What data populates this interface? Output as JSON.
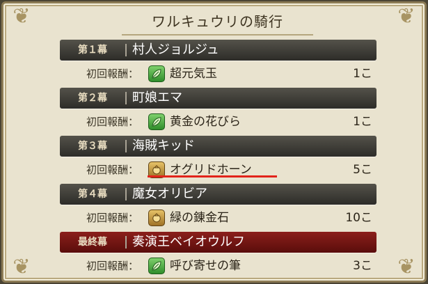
{
  "title": "ワルキュウリの騎行",
  "chapters": [
    {
      "num": "第１幕",
      "name": "村人ジョルジュ",
      "reward_label": "初回報酬：",
      "reward_icon": "green-leaf-icon",
      "reward_item": "超元気玉",
      "reward_qty": "1こ"
    },
    {
      "num": "第２幕",
      "name": "町娘エマ",
      "reward_label": "初回報酬：",
      "reward_icon": "green-leaf-icon",
      "reward_item": "黄金の花びら",
      "reward_qty": "1こ"
    },
    {
      "num": "第３幕",
      "name": "海賊キッド",
      "reward_label": "初回報酬：",
      "reward_icon": "gold-pouch-icon",
      "reward_item": "オグリドホーン",
      "reward_qty": "5こ"
    },
    {
      "num": "第４幕",
      "name": "魔女オリビア",
      "reward_label": "初回報酬：",
      "reward_icon": "gold-pouch-icon",
      "reward_item": "緑の錬金石",
      "reward_qty": "10こ"
    },
    {
      "num": "最終幕",
      "name": "奏演王ベイオウルフ",
      "reward_label": "初回報酬：",
      "reward_icon": "green-leaf-icon",
      "reward_item": "呼び寄せの筆",
      "reward_qty": "3こ"
    }
  ],
  "colors": {
    "chapter_bar": "#3f3d37",
    "final_bar": "#7a1a16",
    "highlight_underline": "#e2231a"
  }
}
